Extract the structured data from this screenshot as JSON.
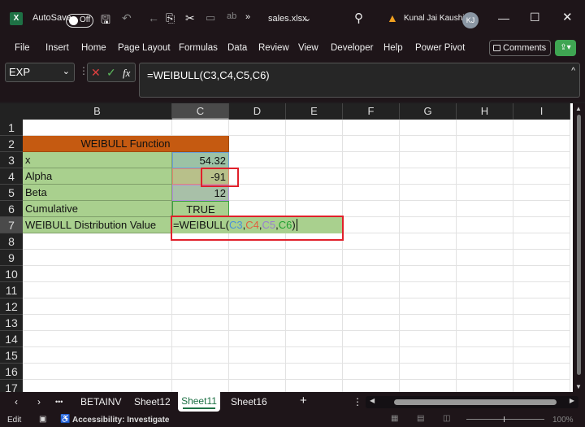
{
  "titlebar": {
    "app_icon": "excel-icon",
    "autosave_label": "AutoSave",
    "autosave_state": "Off",
    "filename": "sales.xlsx",
    "user": "Kunal Jai Kaushik",
    "initials": "KJ",
    "overflow": "»"
  },
  "ribbon": {
    "tabs": [
      "File",
      "Insert",
      "Home",
      "Page Layout",
      "Formulas",
      "Data",
      "Review",
      "View",
      "Developer",
      "Help",
      "Power Pivot"
    ],
    "comments": "Comments"
  },
  "formula_bar": {
    "name_box": "EXP",
    "formula": "=WEIBULL(C3,C4,C5,C6)",
    "fx": "fx"
  },
  "columns": [
    "B",
    "C",
    "D",
    "E",
    "F",
    "G",
    "H",
    "I"
  ],
  "rows": [
    "1",
    "2",
    "3",
    "4",
    "5",
    "6",
    "7",
    "8",
    "9",
    "10",
    "11",
    "12",
    "13",
    "14",
    "15",
    "16",
    "17"
  ],
  "cells": {
    "title": "WEIBULL Function",
    "x_label": "x",
    "x_value": "54.32",
    "alpha_label": "Alpha",
    "alpha_value": "-91",
    "beta_label": "Beta",
    "beta_value": "12",
    "cum_label": "Cumulative",
    "cum_value": "TRUE",
    "result_label": "WEIBULL Distribution Value",
    "edit": {
      "fn": "=WEIBULL(",
      "a1": "C3",
      "a2": "C4",
      "a3": "C5",
      "a4": "C6",
      "comma": ",",
      "close": ")"
    }
  },
  "sheet_tabs": {
    "more": "•••",
    "tabs": [
      "BETAINV",
      "Sheet12",
      "Sheet11",
      "Sheet16"
    ],
    "active": "Sheet11",
    "add": "+"
  },
  "status": {
    "mode": "Edit",
    "accessibility": "Accessibility: Investigate",
    "zoom": "100%"
  },
  "colors": {
    "header_fill": "#c55a11",
    "green_fill": "#a9d08e",
    "highlight": "#e0202a",
    "tab_underline": "#1e7145"
  }
}
